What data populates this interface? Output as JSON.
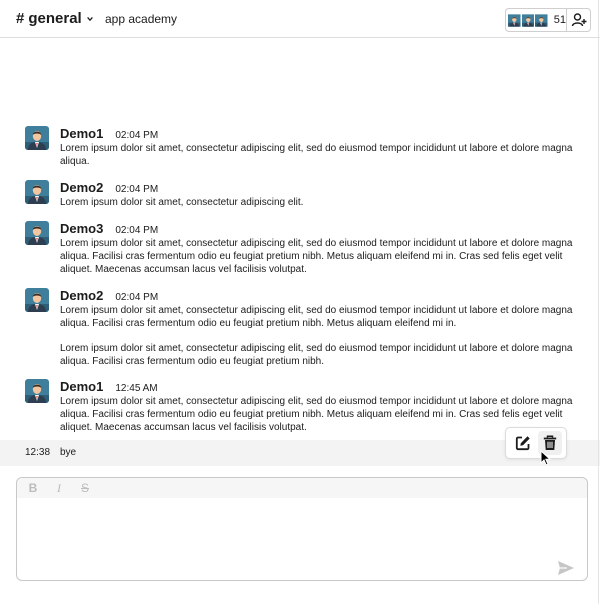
{
  "header": {
    "channel_hash": "#",
    "channel_name": "general",
    "workspace": "app academy",
    "member_count": "51"
  },
  "messages": [
    {
      "author": "Demo1",
      "time": "02:04 PM",
      "text": "Lorem ipsum dolor sit amet, consectetur adipiscing elit, sed do eiusmod tempor incididunt ut labore et dolore magna aliqua."
    },
    {
      "author": "Demo2",
      "time": "02:04 PM",
      "text": "Lorem ipsum dolor sit amet, consectetur adipiscing elit."
    },
    {
      "author": "Demo3",
      "time": "02:04 PM",
      "text": "Lorem ipsum dolor sit amet, consectetur adipiscing elit, sed do eiusmod tempor incididunt ut labore et dolore magna aliqua. Facilisi cras fermentum odio eu feugiat pretium nibh. Metus aliquam eleifend mi in. Cras sed felis eget velit aliquet. Maecenas accumsan lacus vel facilisis volutpat."
    },
    {
      "author": "Demo2",
      "time": "02:04 PM",
      "text": "Lorem ipsum dolor sit amet, consectetur adipiscing elit, sed do eiusmod tempor incididunt ut labore et dolore magna aliqua. Facilisi cras fermentum odio eu feugiat pretium nibh. Metus aliquam eleifend mi in.",
      "text2": "Lorem ipsum dolor sit amet, consectetur adipiscing elit, sed do eiusmod tempor incididunt ut labore et dolore magna aliqua. Facilisi cras fermentum odio eu feugiat pretium nibh."
    },
    {
      "author": "Demo1",
      "time": "12:45 AM",
      "text": "Lorem ipsum dolor sit amet, consectetur adipiscing elit, sed do eiusmod tempor incididunt ut labore et dolore magna aliqua. Facilisi cras fermentum odio eu feugiat pretium nibh. Metus aliquam eleifend mi in. Cras sed felis eget velit aliquet. Maecenas accumsan lacus vel facilisis volutpat."
    }
  ],
  "hovered_message": {
    "time": "12:38",
    "text": "bye"
  },
  "message_actions": {
    "edit_icon": "edit-icon",
    "delete_icon": "trash-icon"
  },
  "composer": {
    "format_buttons": {
      "bold": "B",
      "italic": "I",
      "strike": "S"
    },
    "send_icon": "send-icon"
  },
  "colors": {
    "text": "#1d1c1d",
    "hover_row": "#f3f3f3",
    "avatar_bg": "#3f7f9c",
    "icon_disabled": "#bcbcbc"
  }
}
